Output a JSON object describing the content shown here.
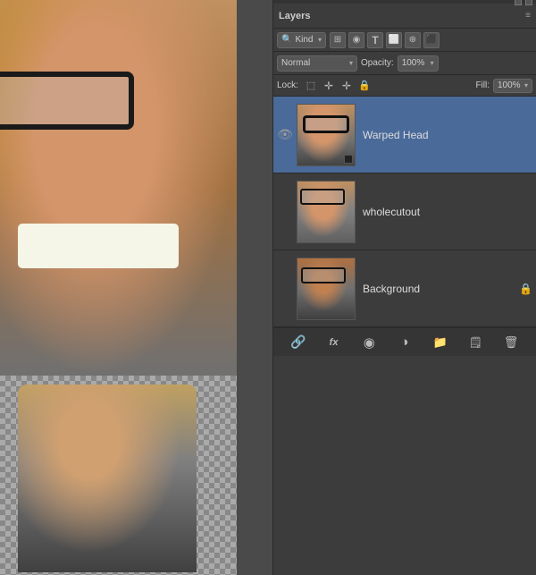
{
  "panel": {
    "title": "Layers",
    "resize_handles": [
      "▲",
      "▼"
    ],
    "close_icon": "✕",
    "menu_icon": "≡"
  },
  "filter_row": {
    "search_icon": "🔍",
    "kind_label": "Kind",
    "filter_icons": [
      "⊞",
      "◉",
      "T",
      "⬜",
      "⊕",
      "⬛"
    ]
  },
  "blend_row": {
    "blend_mode": "Normal",
    "blend_arrow": "▾",
    "opacity_label": "Opacity:",
    "opacity_value": "100%",
    "opacity_arrow": "▾"
  },
  "lock_row": {
    "lock_label": "Lock:",
    "lock_icons": [
      "⬜",
      "✛",
      "↕",
      "🔒"
    ],
    "fill_label": "Fill:",
    "fill_value": "100%",
    "fill_arrow": "▾"
  },
  "layers": [
    {
      "id": "warped-head",
      "name": "Warped Head",
      "visible": true,
      "selected": true,
      "has_mask": true,
      "locked": false
    },
    {
      "id": "wholecutout",
      "name": "wholecutout",
      "visible": false,
      "selected": false,
      "has_mask": false,
      "locked": false
    },
    {
      "id": "background",
      "name": "Background",
      "visible": false,
      "selected": false,
      "has_mask": false,
      "locked": true
    }
  ],
  "actions_bar": {
    "link_icon": "🔗",
    "fx_label": "fx",
    "circle_icon": "◉",
    "half_circle_icon": "◑",
    "folder_icon": "📁",
    "trash_icon": "🗑"
  }
}
